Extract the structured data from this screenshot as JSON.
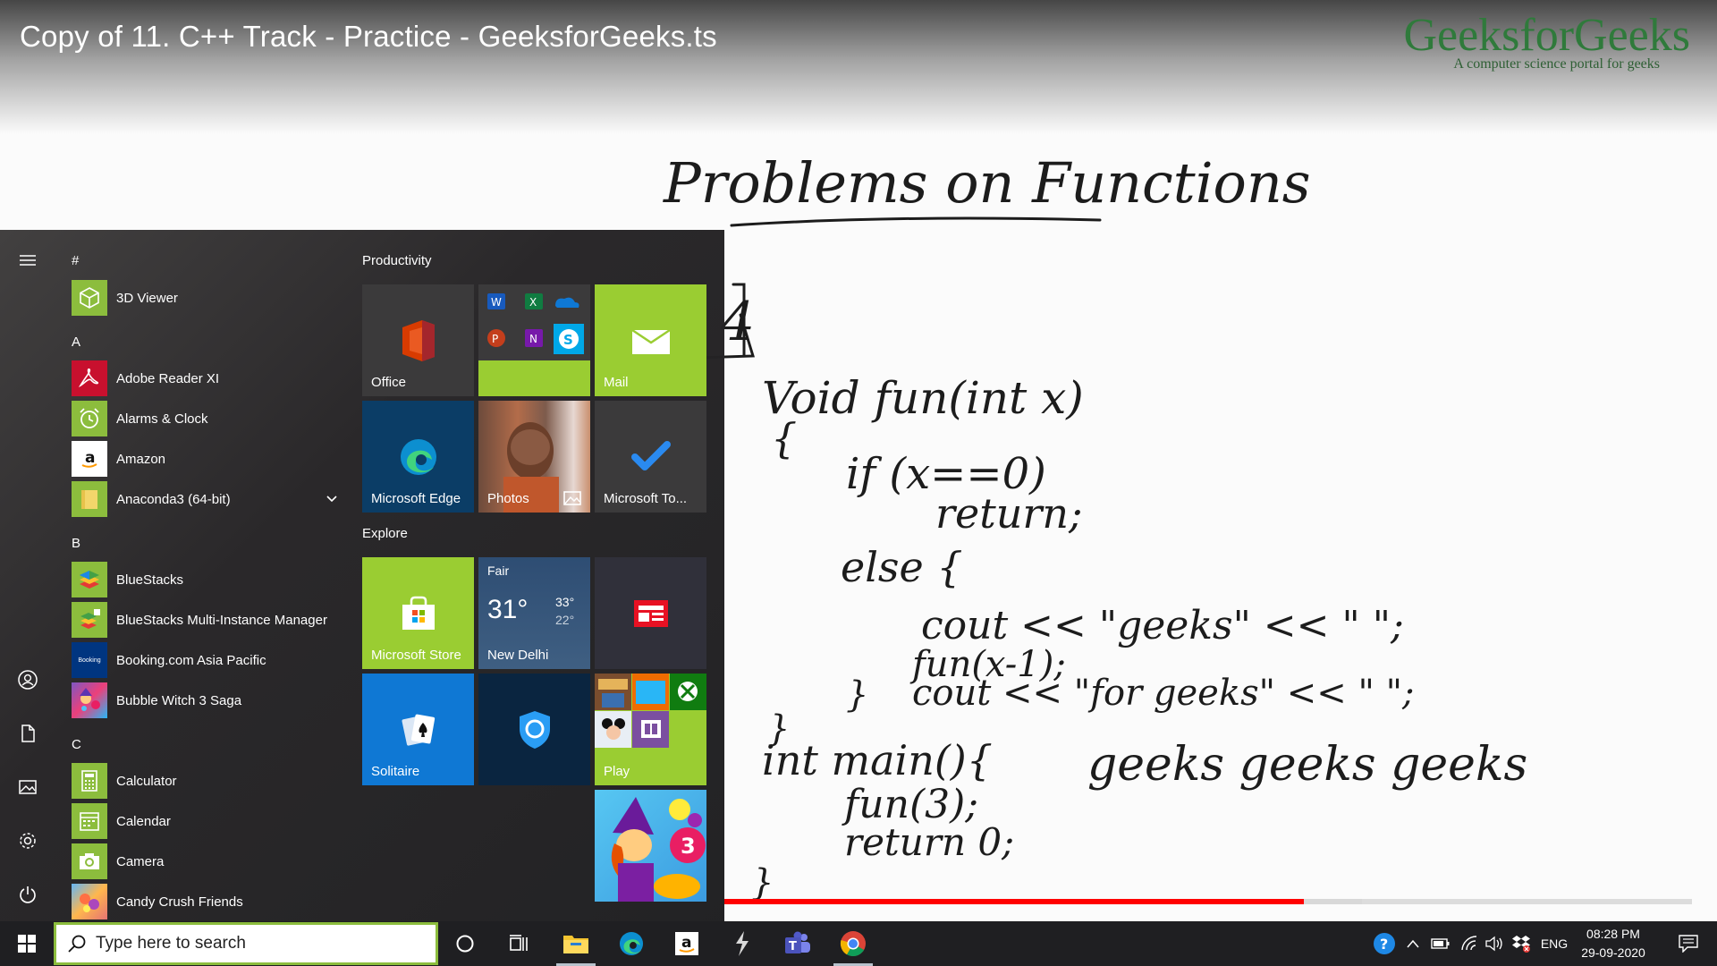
{
  "video": {
    "title": "Copy of 11. C++ Track - Practice - GeeksforGeeks.ts",
    "brand_name": "GeeksforGeeks",
    "brand_tagline": "A computer science portal for geeks",
    "progress_played": 0.6,
    "progress_buffered": 0.66,
    "board": {
      "heading": "Problems on Functions",
      "problem_number": "4",
      "code_lines": [
        "Void fun(int x)",
        "{",
        "if (x==0)",
        "return;",
        "else {",
        "cout << \"geeks\" << \" \";",
        "fun(x-1);",
        "cout << \"for geeks\" << \" \";",
        "}",
        "}",
        "int main(){",
        "fun(3);",
        "return 0;",
        "}"
      ],
      "output_note": "geeks geeks geeks"
    }
  },
  "start_menu": {
    "rail": [
      {
        "name": "hamburger-menu-icon"
      },
      {
        "name": "user-icon"
      },
      {
        "name": "documents-icon"
      },
      {
        "name": "pictures-icon"
      },
      {
        "name": "settings-icon"
      },
      {
        "name": "power-icon"
      }
    ],
    "app_list": {
      "letters": [
        "#",
        "A",
        "B",
        "C"
      ],
      "apps": [
        {
          "label": "3D Viewer",
          "icon": "cube-icon"
        },
        {
          "label": "Adobe Reader XI",
          "icon": "pdf-icon"
        },
        {
          "label": "Alarms & Clock",
          "icon": "alarm-clock-icon"
        },
        {
          "label": "Amazon",
          "icon": "amazon-icon"
        },
        {
          "label": "Anaconda3 (64-bit)",
          "icon": "folder-icon"
        },
        {
          "label": "BlueStacks",
          "icon": "bluestacks-icon"
        },
        {
          "label": "BlueStacks Multi-Instance Manager",
          "icon": "bluestacks-multi-icon"
        },
        {
          "label": "Booking.com Asia Pacific",
          "icon": "booking-icon",
          "icon_text": "Booking"
        },
        {
          "label": "Bubble Witch 3 Saga",
          "icon": "bubble-witch-icon"
        },
        {
          "label": "Calculator",
          "icon": "calculator-icon"
        },
        {
          "label": "Calendar",
          "icon": "calendar-icon"
        },
        {
          "label": "Camera",
          "icon": "camera-icon"
        },
        {
          "label": "Candy Crush Friends",
          "icon": "candy-crush-icon"
        }
      ]
    },
    "groups": [
      {
        "title": "Productivity"
      },
      {
        "title": "Explore"
      }
    ],
    "tiles": {
      "office": "Office",
      "mail": "Mail",
      "edge": "Microsoft Edge",
      "photos": "Photos",
      "todo": "Microsoft To...",
      "store": "Microsoft Store",
      "weather": {
        "condition": "Fair",
        "temp": "31°",
        "high": "33°",
        "low": "22°",
        "city": "New Delhi"
      },
      "solitaire": "Solitaire",
      "play": "Play"
    }
  },
  "taskbar": {
    "search_placeholder": "Type here to search",
    "pinned": [
      {
        "name": "cortana-icon"
      },
      {
        "name": "task-view-icon"
      },
      {
        "name": "file-explorer-icon"
      },
      {
        "name": "edge-icon"
      },
      {
        "name": "amazon-icon"
      },
      {
        "name": "winamp-icon"
      },
      {
        "name": "teams-icon"
      },
      {
        "name": "chrome-icon"
      }
    ],
    "language": "ENG",
    "time": "08:28 PM",
    "date": "29-09-2020"
  },
  "colors": {
    "accent_green": "#9acd32",
    "taskbar": "#1f1f22",
    "progress_red": "#ff0000",
    "brand_green": "#2f7a3b"
  }
}
